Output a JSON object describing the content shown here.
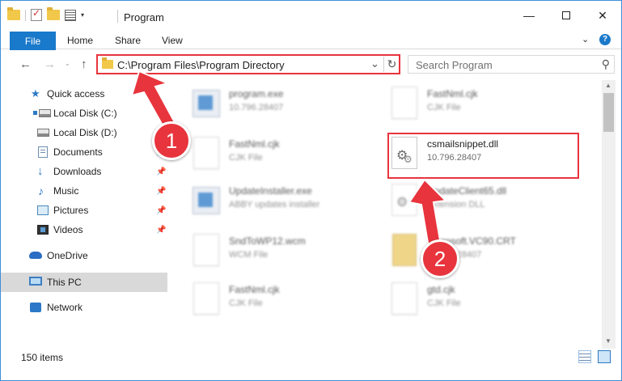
{
  "window": {
    "title": "Program",
    "controls": {
      "minimize": "—",
      "maximize": "",
      "close": "✕"
    }
  },
  "ribbon": {
    "tabs": [
      {
        "label": "File"
      },
      {
        "label": "Home"
      },
      {
        "label": "Share"
      },
      {
        "label": "View"
      }
    ],
    "help": "?",
    "expand": "⌄"
  },
  "navigation": {
    "back": "←",
    "forward": "→",
    "recent": "⌄",
    "up": "↑",
    "address": "C:\\Program Files\\Program Directory",
    "address_dropdown": "⌄",
    "refresh": "↻",
    "search_placeholder": "Search Program",
    "search_icon": "⚲"
  },
  "sidebar": {
    "items": [
      {
        "label": "Quick access",
        "icon": "star-icon"
      },
      {
        "label": "Local Disk (C:)",
        "icon": "disk-icon"
      },
      {
        "label": "Local Disk (D:)",
        "icon": "disk-icon"
      },
      {
        "label": "Documents",
        "icon": "documents-icon"
      },
      {
        "label": "Downloads",
        "icon": "download-icon"
      },
      {
        "label": "Music",
        "icon": "music-icon"
      },
      {
        "label": "Pictures",
        "icon": "pictures-icon"
      },
      {
        "label": "Videos",
        "icon": "videos-icon"
      },
      {
        "label": "OneDrive",
        "icon": "cloud-icon"
      },
      {
        "label": "This PC",
        "icon": "computer-icon",
        "selected": true
      },
      {
        "label": "Network",
        "icon": "network-icon"
      }
    ],
    "pin": "📌"
  },
  "files": [
    {
      "name": "program.exe",
      "desc": "10.796.28407",
      "icon": "exe-icon"
    },
    {
      "name": "FastNml.cjk",
      "desc": "CJK File",
      "icon": "file-icon"
    },
    {
      "name": "FastNml.cjk",
      "desc": "CJK File",
      "icon": "file-icon"
    },
    {
      "name": "csmailsnippet.dll",
      "desc": "10.796.28407",
      "icon": "dll-gear-icon",
      "highlighted": true
    },
    {
      "name": "UpdateInstaller.exe",
      "desc": "ABBY updates installer",
      "icon": "exe-icon"
    },
    {
      "name": "UpdateClient65.dll",
      "desc": "Extension DLL",
      "icon": "dll-gear-icon"
    },
    {
      "name": "SndToWP12.wcm",
      "desc": "WCM File",
      "icon": "file-icon"
    },
    {
      "name": "Microsoft.VC90.CRT",
      "desc": "10.796.28407",
      "icon": "folder-icon"
    },
    {
      "name": "FastNml.cjk",
      "desc": "CJK File",
      "icon": "file-icon"
    },
    {
      "name": "gtd.cjk",
      "desc": "CJK File",
      "icon": "file-icon"
    }
  ],
  "status": {
    "item_count": "150 items"
  },
  "annotations": {
    "badge_1": "1",
    "badge_2": "2",
    "highlight_color": "#e8343d"
  }
}
